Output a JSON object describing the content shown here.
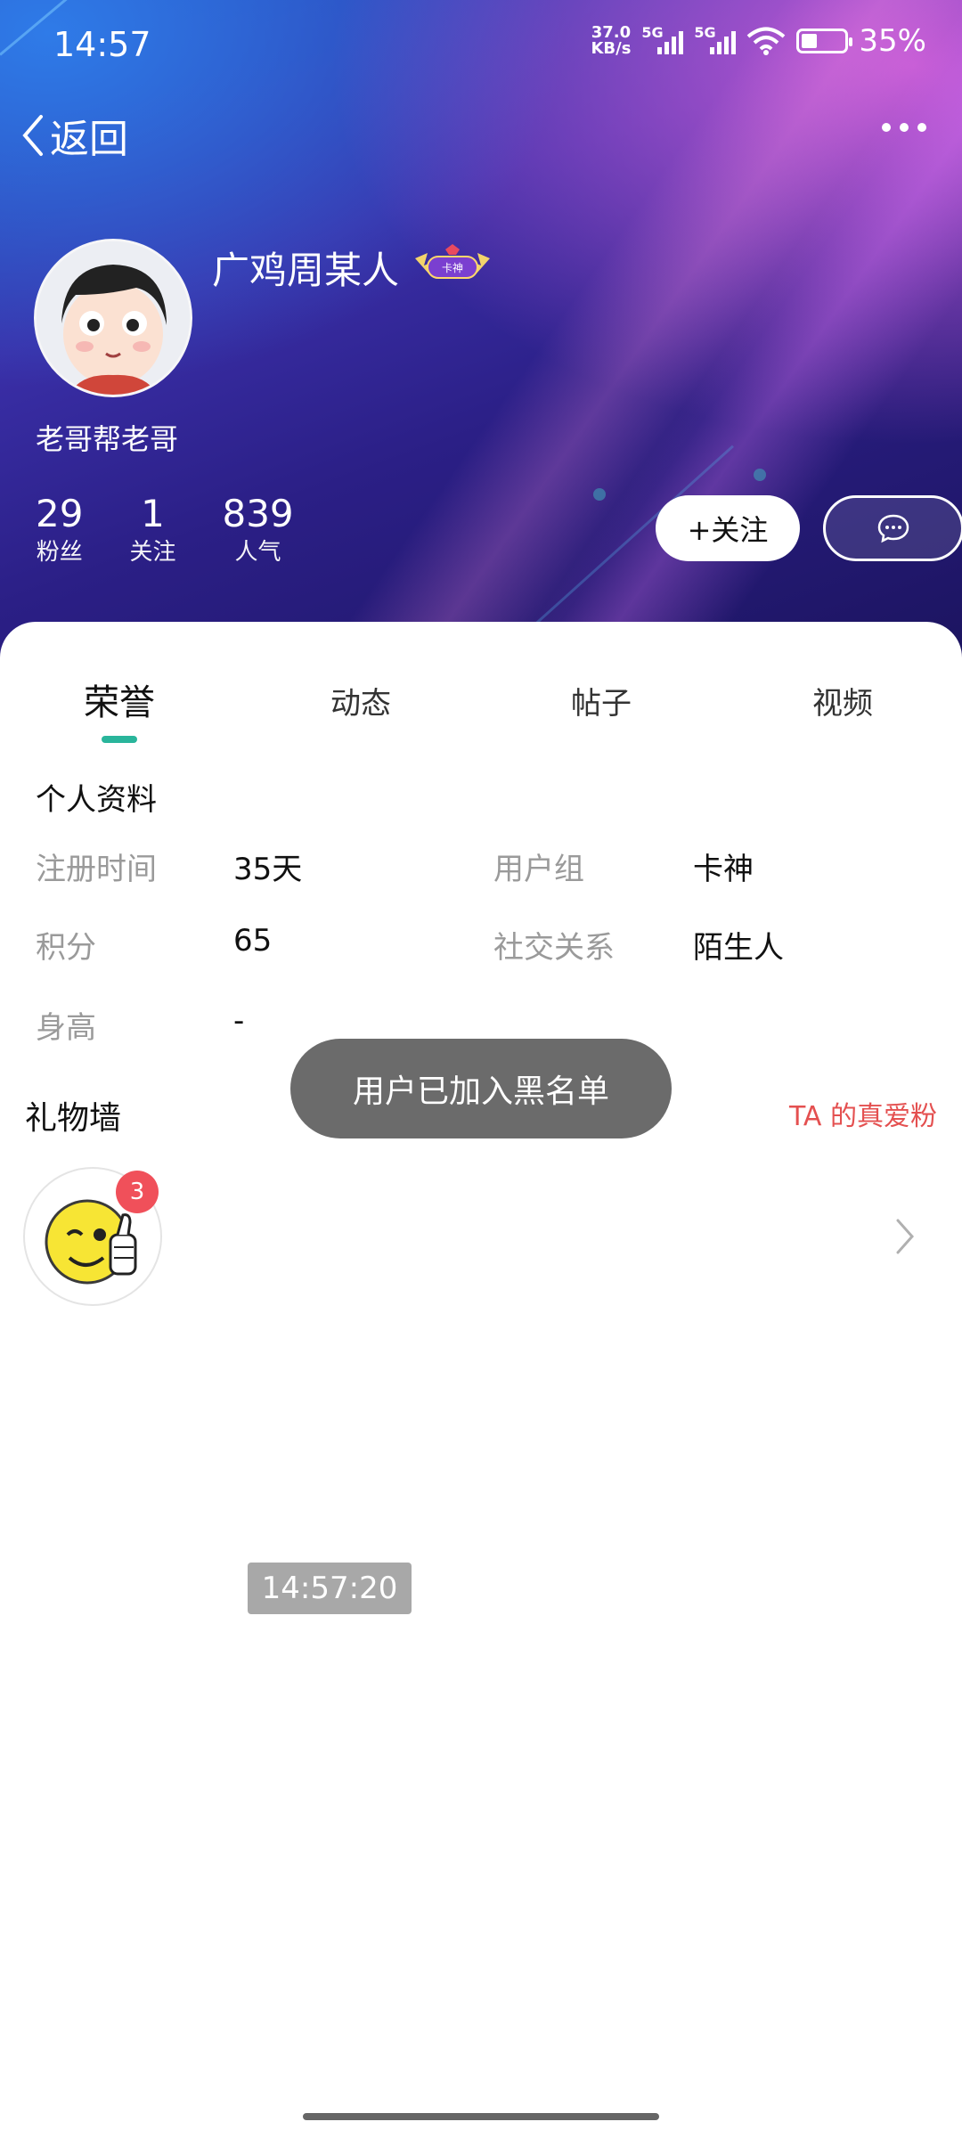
{
  "status_bar": {
    "time": "14:57",
    "net_speed_value": "37.0",
    "net_speed_unit": "KB/s",
    "sim1_label": "5G",
    "sim2_label": "5G",
    "battery_percent": "35%",
    "battery_level": 0.35
  },
  "nav": {
    "back_label": "返回",
    "more_icon": "more-dots-icon"
  },
  "profile": {
    "username": "广鸡周某人",
    "badge_text": "卡神",
    "signature": "老哥帮老哥",
    "stats": [
      {
        "value": "29",
        "label": "粉丝"
      },
      {
        "value": "1",
        "label": "关注"
      },
      {
        "value": "839",
        "label": "人气"
      }
    ],
    "follow_label": "+关注",
    "chat_icon": "chat-bubble-icon"
  },
  "tabs": [
    {
      "label": "荣誉",
      "active": true
    },
    {
      "label": "动态",
      "active": false
    },
    {
      "label": "帖子",
      "active": false
    },
    {
      "label": "视频",
      "active": false
    }
  ],
  "personal_info": {
    "title": "个人资料",
    "fields": [
      {
        "key": "注册时间",
        "value": "35天"
      },
      {
        "key": "用户组",
        "value": "卡神"
      },
      {
        "key": "积分",
        "value": "65"
      },
      {
        "key": "社交关系",
        "value": "陌生人"
      },
      {
        "key": "身高",
        "value": "-"
      }
    ]
  },
  "gift_wall": {
    "title": "礼物墙",
    "fans_link": "TA 的真爱粉",
    "gift_count": "3",
    "gift_icon": "thumbs-up-emoji-icon"
  },
  "toast": "用户已加入黑名单",
  "timestamp": "14:57:20",
  "colors": {
    "accent": "#29b59b",
    "fans_link": "#e45050",
    "count_badge": "#f0505a",
    "toast_bg": "#6b6b6b"
  }
}
